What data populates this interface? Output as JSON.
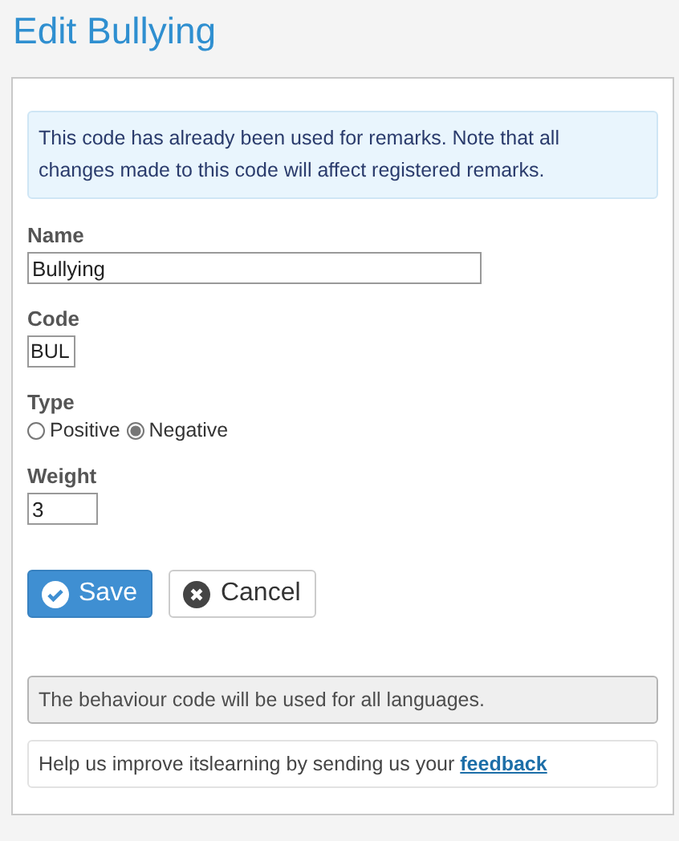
{
  "title": "Edit Bullying",
  "notice": "This code has already been used for remarks. Note that all changes made to this code will affect registered remarks.",
  "fields": [
    {
      "label": "Name",
      "value": "Bullying",
      "kind": "wide"
    },
    {
      "label": "Code",
      "value": "BUL",
      "kind": "tiny"
    },
    {
      "label": "Type",
      "kind": "radio",
      "options": [
        {
          "label": "Positive",
          "selected": false
        },
        {
          "label": "Negative",
          "selected": true
        }
      ]
    },
    {
      "label": "Weight",
      "value": "3",
      "kind": "small"
    }
  ],
  "buttons": [
    {
      "label": "Save",
      "kind": "primary"
    },
    {
      "label": "Cancel",
      "kind": "secondary"
    }
  ],
  "language_note": "The behaviour code will be used for all languages.",
  "help": {
    "text": "Help us improve itslearning by sending us your",
    "link": "feedback"
  }
}
